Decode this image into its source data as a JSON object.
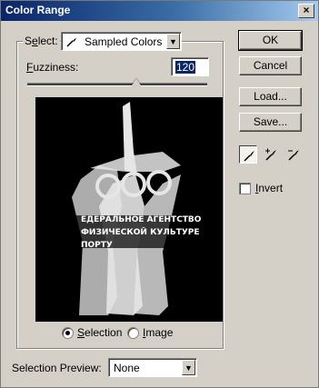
{
  "window": {
    "title": "Color Range",
    "close_glyph": "×"
  },
  "select": {
    "label_pre": "S",
    "label_u": "e",
    "label_post": "lect:",
    "value": "Sampled Colors",
    "icon": "eyedropper-icon"
  },
  "fuzziness": {
    "label_u": "F",
    "label_post": "uzziness:",
    "value": "120",
    "slider_fraction": 0.6
  },
  "preview": {
    "text_lines": [
      "ЕДЕРАЛЬНОЕ АГЕНТСТВО",
      "ФИЗИЧЕСКОЙ КУЛЬТУРЕ",
      "ПОРТУ"
    ]
  },
  "mode": {
    "options": [
      {
        "u": "S",
        "rest": "election",
        "selected": true
      },
      {
        "u": "I",
        "rest": "mage",
        "selected": false
      }
    ]
  },
  "selection_preview": {
    "label": "Selection Preview:",
    "value": "None"
  },
  "buttons": {
    "ok": "OK",
    "cancel": "Cancel",
    "load": "Load...",
    "save": "Save..."
  },
  "tools": [
    {
      "name": "eyedropper-icon",
      "active": true
    },
    {
      "name": "eyedropper-plus-icon",
      "active": false
    },
    {
      "name": "eyedropper-minus-icon",
      "active": false
    }
  ],
  "invert": {
    "label_u": "I",
    "label_post": "nvert",
    "checked": false
  },
  "colors": {
    "selection_bg": "#0a246a",
    "dialog_bg": "#d4d0c8"
  }
}
